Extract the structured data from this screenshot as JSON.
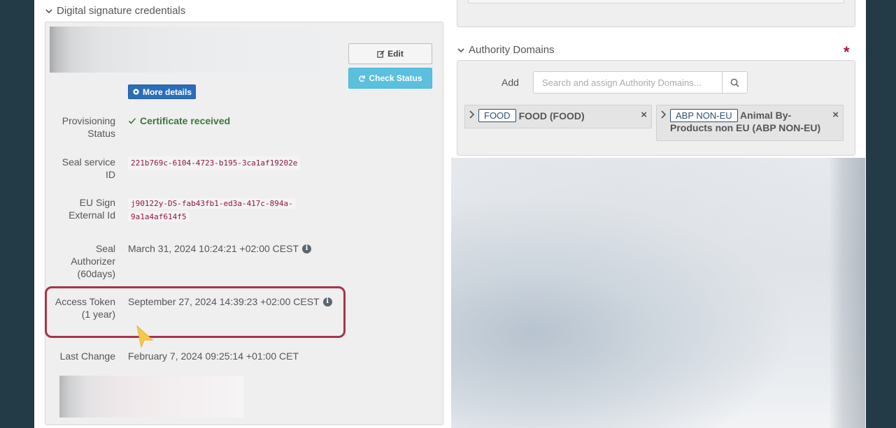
{
  "left": {
    "section_title": "Digital signature credentials",
    "buttons": {
      "edit": "Edit",
      "check_status": "Check Status",
      "more_details": "More details"
    },
    "rows": {
      "provisioning_status": {
        "label": "Provisioning Status",
        "value": "Certificate received"
      },
      "seal_service_id": {
        "label": "Seal service ID",
        "value": "221b769c-6104-4723-b195-3ca1af19202e"
      },
      "eu_sign_external_id": {
        "label": "EU Sign External Id",
        "value_line1": "j90122y-DS-fab43fb1-ed3a-417c-894a-",
        "value_line2": "9a1a4af614f5"
      },
      "seal_authorizer": {
        "label": "Seal Authorizer (60days)",
        "value": "March 31, 2024 10:24:21 +02:00 CEST"
      },
      "access_token": {
        "label": "Access Token (1 year)",
        "value": "September 27, 2024 14:39:23 +02:00 CEST"
      },
      "last_change": {
        "label": "Last Change",
        "value": "February 7, 2024 09:25:14 +01:00 CET"
      }
    }
  },
  "right": {
    "section_title": "Authority Domains",
    "required_marker": "*",
    "add_label": "Add",
    "search_placeholder": "Search and assign Authority Domains...",
    "tags": [
      {
        "code": "FOOD",
        "name": "FOOD (FOOD)",
        "close": "×"
      },
      {
        "code": "ABP NON-EU",
        "name": "Animal By-Products non EU (ABP NON-EU)",
        "close": "×"
      }
    ]
  },
  "colors": {
    "background": "#233a47",
    "highlight": "#a3364b",
    "success": "#3c763d",
    "primary": "#2a6ebb",
    "info": "#5bc0de",
    "required": "#a31d3a"
  }
}
